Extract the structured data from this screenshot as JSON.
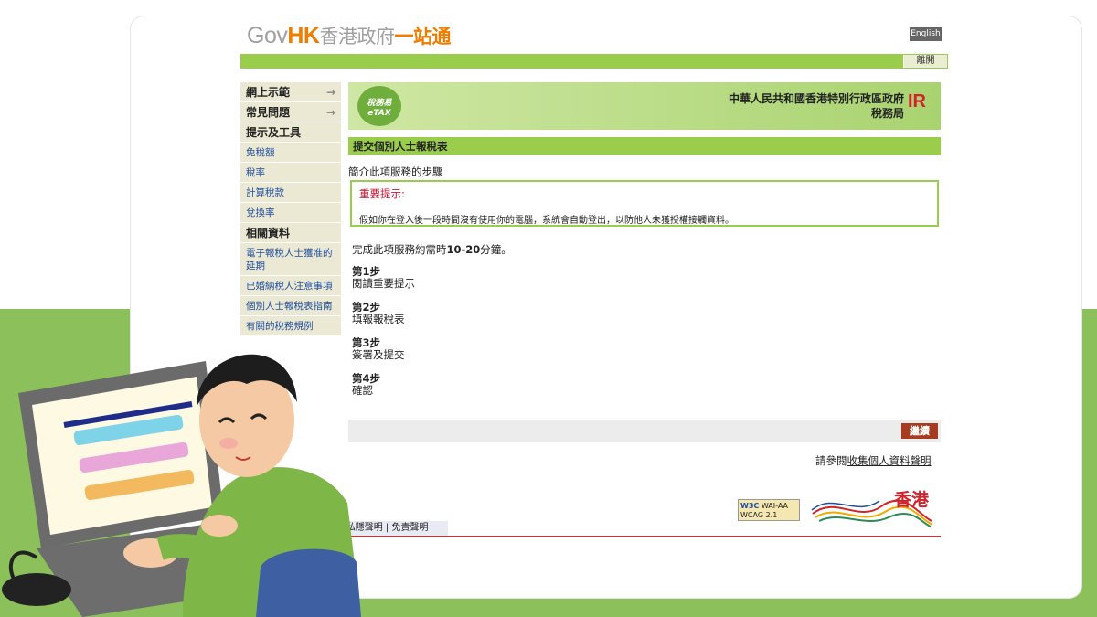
{
  "header": {
    "logo_gov": "Gov",
    "logo_hk": "HK",
    "logo_zh_1": "香港政府",
    "logo_zh_2": "一站通",
    "lang_button": "English",
    "logout_button": "離開"
  },
  "sidebar": {
    "items": [
      {
        "label": "網上示範",
        "type": "head",
        "arrow": "→"
      },
      {
        "label": "常見問題",
        "type": "head",
        "arrow": "→"
      },
      {
        "label": "提示及工具",
        "type": "head"
      },
      {
        "label": "免稅額",
        "type": "link"
      },
      {
        "label": "稅率",
        "type": "link"
      },
      {
        "label": "計算稅款",
        "type": "link"
      },
      {
        "label": "兌換率",
        "type": "link"
      },
      {
        "label": "相關資料",
        "type": "head"
      },
      {
        "label": "電子報稅人士獲准的延期",
        "type": "link"
      },
      {
        "label": "已婚納稅人注意事項",
        "type": "link"
      },
      {
        "label": "個別人士報稅表指南",
        "type": "link"
      },
      {
        "label": "有關的稅務規例",
        "type": "link"
      }
    ]
  },
  "banner": {
    "etax_zh": "稅務易",
    "etax_en": "eTAX",
    "dept_line1": "中華人民共和國香港特別行政區政府",
    "dept_line2": "稅務局",
    "dept_logo": "IR"
  },
  "main": {
    "title": "提交個別人士報稅表",
    "intro": "簡介此項服務的步驟",
    "notice_title": "重要提示:",
    "notice_text": "假如你在登入後一段時間沒有使用你的電腦，系統會自動登出，以防他人未獲授權接觸資料。",
    "duration_pre": "完成此項服務約需時",
    "duration_bold": "10-20",
    "duration_post": "分鐘。",
    "steps": [
      {
        "no": "第1步",
        "text": "閱讀重要提示"
      },
      {
        "no": "第2步",
        "text": "填報報稅表"
      },
      {
        "no": "第3步",
        "text": "簽署及提交"
      },
      {
        "no": "第4步",
        "text": "確認"
      }
    ],
    "continue_button": "繼續",
    "privacy_pre": "請參閱",
    "privacy_link": "收集個人資料聲明"
  },
  "footer": {
    "w3c_label": "W3C",
    "wai_line1": "WAI-AA",
    "wai_line2": "WCAG 2.1",
    "brand_hk": "香港",
    "links": "示 | 私隱聲明 | 免責聲明"
  }
}
